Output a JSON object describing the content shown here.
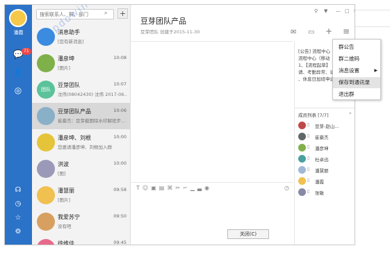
{
  "user": {
    "name": "潘霞"
  },
  "nav": {
    "badge": "71"
  },
  "search": {
    "placeholder": "搜索联系人、群、部门"
  },
  "conversations": [
    {
      "name": "消息助手",
      "time": "",
      "preview": "[您有新消息]",
      "color": "#3b8be0"
    },
    {
      "name": "潘彦坤",
      "time": "10:08",
      "preview": "[图片]",
      "color": "#7fb04a"
    },
    {
      "name": "豆芽团队",
      "time": "10:07",
      "preview": "沈伟(08042430) 沈伟 2017-06...",
      "color": "#5bc29a",
      "avatar_text": "团队"
    },
    {
      "name": "豆芽团队产品",
      "time": "10:06",
      "preview": "崔豪杰：豆芽截图除水印解密步...",
      "color": "#8ab0c8"
    },
    {
      "name": "潘彦坤、刘根",
      "time": "10:00",
      "preview": "您邀请潘彦坤、刘根加入群",
      "color": "#e6c43a"
    },
    {
      "name": "洪波",
      "time": "10:00",
      "preview": "[图]",
      "color": "#9a9ab8"
    },
    {
      "name": "潘慧丽",
      "time": "09:58",
      "preview": "[图片]",
      "color": "#f0c050"
    },
    {
      "name": "我爱苏宁",
      "time": "09:50",
      "preview": "没有吧",
      "color": "#d8a060"
    },
    {
      "name": "徐维佳",
      "time": "09:45",
      "preview": "[图片]",
      "color": "#e86a8a",
      "avatar_text": "维佳"
    }
  ],
  "chat": {
    "title": "豆芽团队产品",
    "subtitle": "豆芽团队 创建于2015-11-30",
    "close_label": "关闭(C)",
    "notice_label": "[公告] 流程中心（移动",
    "notice_lines": [
      "流程中心（移动",
      "1、【流程起草】",
      "请、考勤异常、请",
      "、休息日加班申请"
    ]
  },
  "members": {
    "header": "成员列表 [7/7]",
    "list": [
      {
        "name": "豆芽-赵山...",
        "color": "#c04848"
      },
      {
        "name": "崔豪杰",
        "color": "#606868"
      },
      {
        "name": "潘彦坤",
        "color": "#7fb04a"
      },
      {
        "name": "杜卓迅",
        "color": "#4aa0a0"
      },
      {
        "name": "潘慧丽",
        "color": "#a0b8d8"
      },
      {
        "name": "潘霞",
        "color": "#f0c050"
      },
      {
        "name": "张敏",
        "color": "#8888a8"
      }
    ]
  },
  "menu": {
    "items": [
      "群公告",
      "群二维码",
      "消息设置",
      "保存到通讯录",
      "退出群"
    ]
  },
  "watermark": "pdowin.net"
}
